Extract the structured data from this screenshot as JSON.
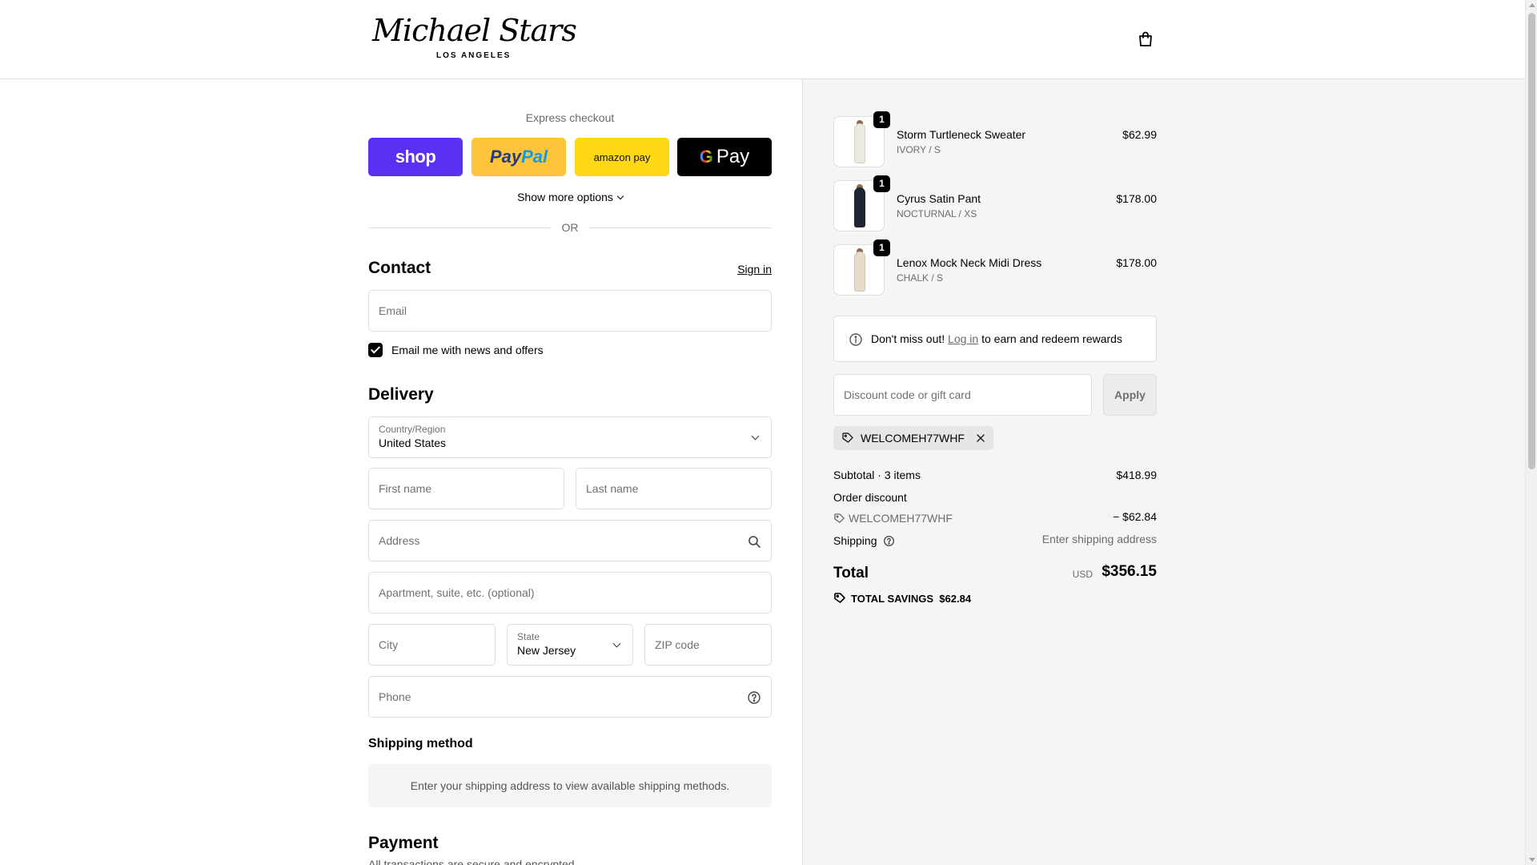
{
  "brand": {
    "logo_script": "Michael Stars",
    "logo_sub": "LOS ANGELES"
  },
  "express": {
    "title": "Express checkout",
    "shop_label": "shop",
    "paypal_label_1": "Pay",
    "paypal_label_2": "Pal",
    "amazon_label": "amazon pay",
    "gpay_label": "Pay",
    "gpay_g": "G",
    "more_options": "Show more options",
    "or_text": "OR"
  },
  "contact": {
    "title": "Contact",
    "signin": "Sign in",
    "email_placeholder": "Email",
    "newsletter_label": "Email me with news and offers",
    "newsletter_checked": true
  },
  "delivery": {
    "title": "Delivery",
    "country_label": "Country/Region",
    "country_value": "United States",
    "first_name_placeholder": "First name",
    "last_name_placeholder": "Last name",
    "address_placeholder": "Address",
    "apartment_placeholder": "Apartment, suite, etc. (optional)",
    "city_placeholder": "City",
    "state_label": "State",
    "state_value": "New Jersey",
    "zip_placeholder": "ZIP code",
    "phone_placeholder": "Phone"
  },
  "shipping_method": {
    "title": "Shipping method",
    "message": "Enter your shipping address to view available shipping methods."
  },
  "payment": {
    "title": "Payment",
    "subtitle": "All transactions are secure and encrypted."
  },
  "cart": {
    "items": [
      {
        "name": "Storm Turtleneck Sweater",
        "variant": "IVORY / S",
        "price": "$62.99",
        "qty": "1",
        "color": "#ede9e0"
      },
      {
        "name": "Cyrus Satin Pant",
        "variant": "NOCTURNAL / XS",
        "price": "$178.00",
        "qty": "1",
        "color": "#1f2433"
      },
      {
        "name": "Lenox Mock Neck Midi Dress",
        "variant": "CHALK / S",
        "price": "$178.00",
        "qty": "1",
        "color": "#e6dccb"
      }
    ],
    "rewards_prefix": "Don't miss out!",
    "rewards_login": "Log in",
    "rewards_suffix": "to earn and redeem rewards",
    "discount_placeholder": "Discount code or gift card",
    "apply_label": "Apply",
    "applied_code": "WELCOMEH77WHF",
    "subtotal_label": "Subtotal · 3 items",
    "subtotal_value": "$418.99",
    "order_discount_label": "Order discount",
    "discount_code": "WELCOMEH77WHF",
    "discount_value": "− $62.84",
    "shipping_label": "Shipping",
    "shipping_value": "Enter shipping address",
    "total_label": "Total",
    "total_currency": "USD",
    "total_value": "$356.15",
    "savings_label": "TOTAL SAVINGS",
    "savings_value": "$62.84"
  }
}
